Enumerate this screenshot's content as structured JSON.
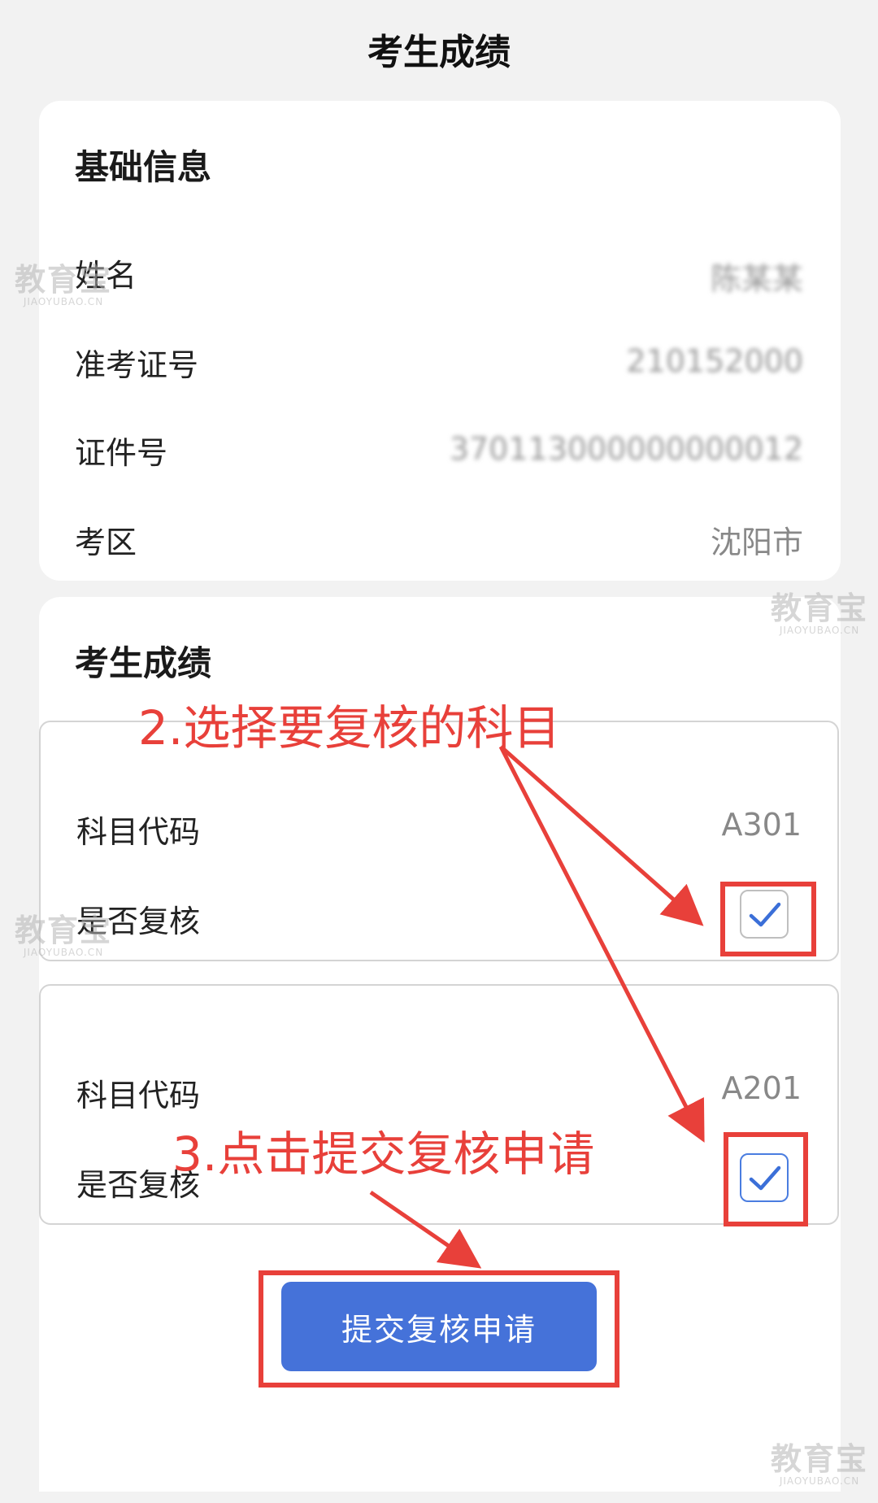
{
  "header": {
    "title": "考生成绩"
  },
  "basic_info": {
    "title": "基础信息",
    "rows": [
      {
        "label": "姓名",
        "value": "陈某某"
      },
      {
        "label": "准考证号",
        "value": "210152000"
      },
      {
        "label": "证件号",
        "value": "370113000000000012"
      },
      {
        "label": "考区",
        "value": "沈阳市"
      }
    ]
  },
  "scores": {
    "title": "考生成绩",
    "subjects": [
      {
        "code_label": "科目代码",
        "code_value": "A301",
        "review_label": "是否复核",
        "review_checked": true
      },
      {
        "code_label": "科目代码",
        "code_value": "A201",
        "review_label": "是否复核",
        "review_checked": true
      }
    ]
  },
  "submit": {
    "label": "提交复核申请"
  },
  "annotations": {
    "step2": "2.选择要复核的科目",
    "step3": "3.点击提交复核申请",
    "color": "#e8403a"
  },
  "watermark": {
    "main": "教育宝",
    "sub": "JIAOYUBAO.CN"
  },
  "colors": {
    "accent": "#4572d9",
    "background": "#f2f2f2"
  }
}
